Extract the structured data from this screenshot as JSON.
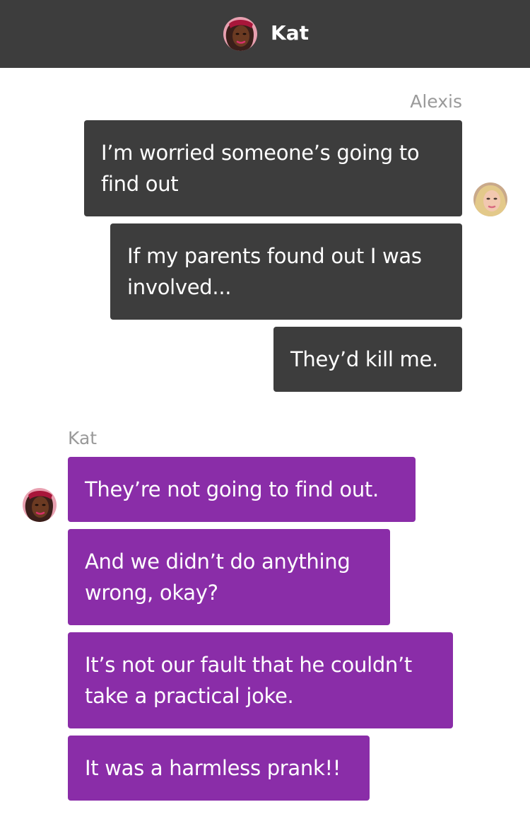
{
  "header": {
    "title": "Kat",
    "avatar_icon": "kat-avatar"
  },
  "groups": [
    {
      "sender": "Alexis",
      "direction": "outgoing",
      "avatar_icon": "alexis-avatar",
      "messages": [
        "I’m worried someone’s going to\nfind out",
        "If my parents found out I was\ninvolved...",
        "They’d kill me."
      ]
    },
    {
      "sender": "Kat",
      "direction": "incoming",
      "avatar_icon": "kat-avatar",
      "messages": [
        "They’re not going to find out.",
        "And we didn’t do anything\nwrong, okay?",
        "It’s not our fault that he couldn’t\ntake a practical joke.",
        "It was a harmless prank!!"
      ]
    }
  ],
  "colors": {
    "header_bg": "#3d3d3d",
    "outgoing_bubble": "#3d3d3d",
    "incoming_bubble": "#8a2da8",
    "sender_label": "#9a9a9a"
  }
}
